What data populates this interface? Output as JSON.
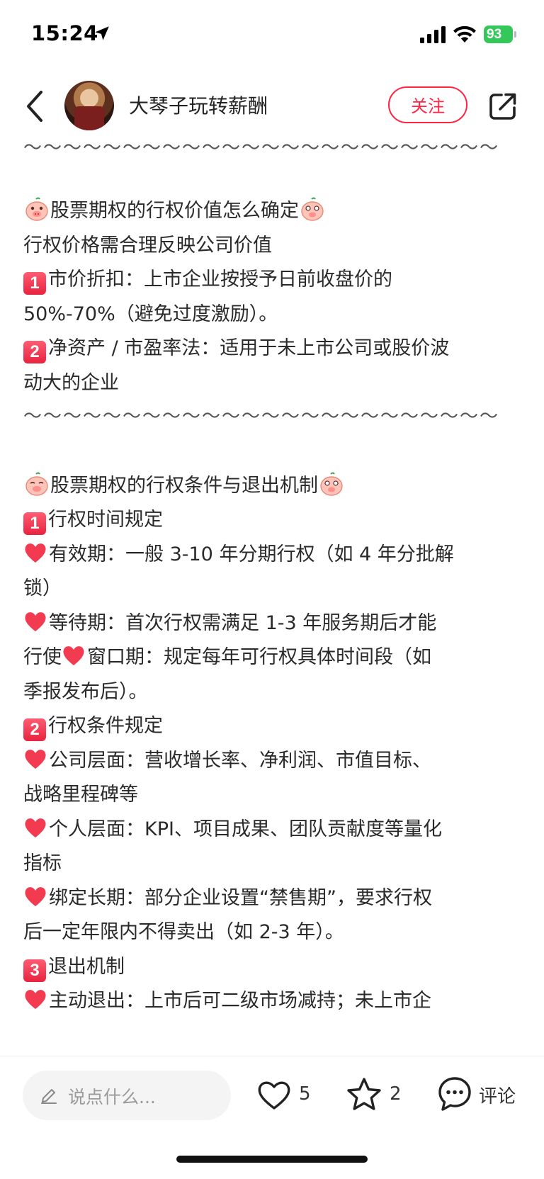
{
  "status_bar": {
    "time": "15:24",
    "battery": "93"
  },
  "header": {
    "author": "大琴子玩转薪酬",
    "follow_label": "关注"
  },
  "content": {
    "divider": "～～～～～～～～～～～～～～～～～～～～～～～～",
    "section1": {
      "title": "股票期权的行权价值怎么确定",
      "intro": "行权价格需合理反映公司价值",
      "item1_num": "1",
      "item1_a": "市价折扣：上市企业按授予日前收盘价的",
      "item1_b": "50%-70%（避免过度激励）。",
      "item2_num": "2",
      "item2_a": "净资产 / 市盈率法：适用于未上市公司或股价波",
      "item2_b": "动大的企业"
    },
    "section2": {
      "title": "股票期权的行权条件与退出机制",
      "sub1_num": "1",
      "sub1_title": "行权时间规定",
      "validity_a": "有效期：一般 3-10 年分期行权（如 4 年分批解",
      "validity_b": "锁）",
      "waiting_a": "等待期：首次行权需满足 1-3 年服务期后才能",
      "waiting_b1": "行使",
      "waiting_b2": "窗口期：规定每年可行权具体时间段（如",
      "waiting_c": "季报发布后）。",
      "sub2_num": "2",
      "sub2_title": "行权条件规定",
      "company_a": "公司层面：营收增长率、净利润、市值目标、",
      "company_b": "战略里程碑等",
      "personal_a": "个人层面：KPI、项目成果、团队贡献度等量化",
      "personal_b": "指标",
      "lock_a": "绑定长期：部分企业设置“禁售期”，要求行权",
      "lock_b": "后一定年限内不得卖出（如 2-3 年）。",
      "sub3_num": "3",
      "sub3_title": "退出机制",
      "cutoff": "主动退出：上市后可二级市场减持；未上市企"
    }
  },
  "bottom_bar": {
    "comment_placeholder": "说点什么...",
    "like_count": "5",
    "star_count": "2",
    "comment_label": "评论"
  },
  "colors": {
    "accent": "#ff2442",
    "battery": "#34c759",
    "number_box": "#e8233f"
  },
  "icons": [
    "location-arrow-icon",
    "signal-icon",
    "wifi-icon",
    "battery-icon",
    "back-chevron-icon",
    "share-icon",
    "pig-emoji-icon",
    "heart-emoji-icon",
    "pencil-icon",
    "heart-outline-icon",
    "star-outline-icon",
    "comment-bubble-icon"
  ]
}
